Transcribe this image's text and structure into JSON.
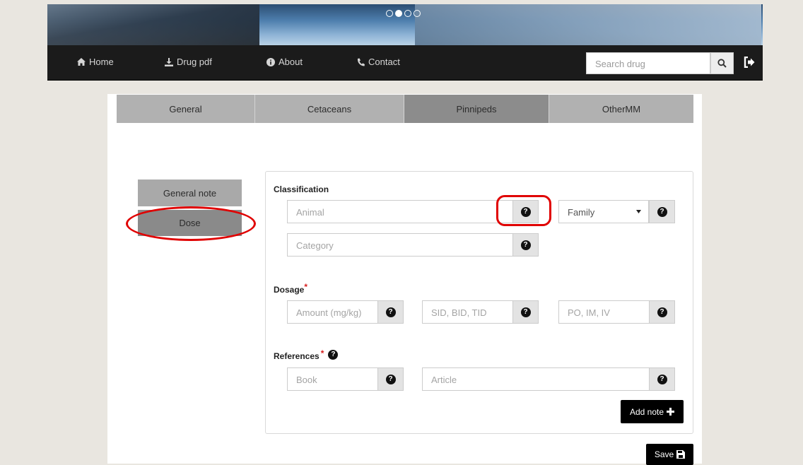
{
  "carousel": {
    "indicators": [
      false,
      true,
      false,
      false
    ]
  },
  "nav": {
    "items": [
      {
        "label": "Home",
        "icon": "home-icon"
      },
      {
        "label": "Drug pdf",
        "icon": "download-icon"
      },
      {
        "label": "About",
        "icon": "info-icon"
      },
      {
        "label": "Contact",
        "icon": "phone-icon"
      }
    ],
    "search_placeholder": "Search drug",
    "logout_icon": "logout-icon"
  },
  "tabs": [
    {
      "label": "General",
      "active": false
    },
    {
      "label": "Cetaceans",
      "active": false
    },
    {
      "label": "Pinnipeds",
      "active": true
    },
    {
      "label": "OtherMM",
      "active": false
    }
  ],
  "side": {
    "general_note": "General note",
    "dose": "Dose"
  },
  "classification": {
    "title": "Classification",
    "animal_placeholder": "Animal",
    "family_value": "Family",
    "category_placeholder": "Category"
  },
  "dosage": {
    "title": "Dosage",
    "required_mark": "*",
    "amount_placeholder": "Amount (mg/kg)",
    "frequency_placeholder": "SID, BID, TID",
    "route_placeholder": "PO, IM, IV"
  },
  "references": {
    "title": "References",
    "required_mark": "*",
    "book_placeholder": "Book",
    "article_placeholder": "Article"
  },
  "buttons": {
    "add_note": "Add note",
    "save": "Save"
  },
  "colors": {
    "highlight_ring": "#e00000",
    "active_tab": "#8c8c8c",
    "navbar": "#1b1b1b"
  }
}
